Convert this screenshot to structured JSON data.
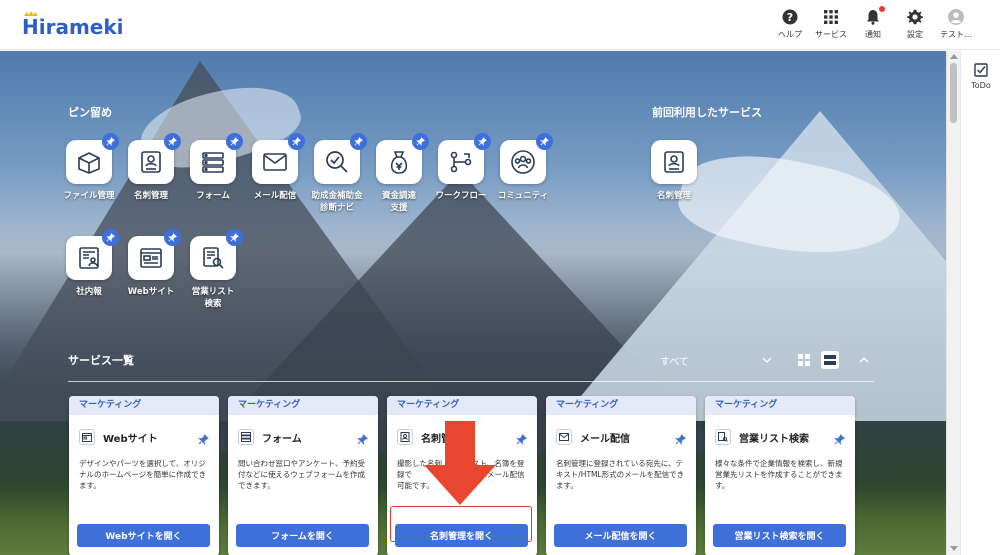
{
  "header": {
    "logo": "Hirameki 7",
    "nav": [
      {
        "label": "ヘルプ",
        "icon": "help-icon"
      },
      {
        "label": "サービス",
        "icon": "grid-icon"
      },
      {
        "label": "通知",
        "icon": "bell-icon"
      },
      {
        "label": "設定",
        "icon": "gear-icon"
      },
      {
        "label": "テスト…",
        "icon": "user-icon"
      }
    ]
  },
  "pinned": {
    "title": "ピン留め",
    "items": [
      {
        "label": "ファイル管理",
        "icon": "box-icon"
      },
      {
        "label": "名刺管理",
        "icon": "card-icon"
      },
      {
        "label": "フォーム",
        "icon": "form-icon"
      },
      {
        "label": "メール配信",
        "icon": "mail-icon"
      },
      {
        "label": "助成金補助金\n診断ナビ",
        "icon": "check-search-icon"
      },
      {
        "label": "資金調達\n支援",
        "icon": "money-bag-icon"
      },
      {
        "label": "ワークフロー",
        "icon": "workflow-icon"
      },
      {
        "label": "コミュニティ",
        "icon": "community-icon"
      },
      {
        "label": "社内報",
        "icon": "newsletter-icon"
      },
      {
        "label": "Webサイト",
        "icon": "website-icon"
      },
      {
        "label": "営業リスト\n検索",
        "icon": "list-search-icon"
      }
    ]
  },
  "recent": {
    "title": "前回利用したサービス",
    "items": [
      {
        "label": "名刺管理",
        "icon": "card-icon"
      }
    ]
  },
  "services": {
    "title": "サービス一覧",
    "filter": "すべて",
    "cards": [
      {
        "category": "マーケティング",
        "name": "Webサイト",
        "icon": "website-icon",
        "desc": "デザインやパーツを選択して、オリジナルのホームページを簡単に作成できます。",
        "button": "Webサイトを開く"
      },
      {
        "category": "マーケティング",
        "name": "フォーム",
        "icon": "form-icon",
        "desc": "問い合わせ窓口やアンケート、予約受付などに使えるウェブフォームを作成できます。",
        "button": "フォームを開く"
      },
      {
        "category": "マーケティング",
        "name": "名刺管",
        "icon": "card-icon",
        "desc": "撮影した名刺　　　　スト、名簿を登録で　　　　　たデータはメール配信　　　　可能です。",
        "button": "名刺管理を開く"
      },
      {
        "category": "マーケティング",
        "name": "メール配信",
        "icon": "mail-icon",
        "desc": "名刺管理に登録されている宛先に、テキスト/HTML形式のメールを配信できます。",
        "button": "メール配信を開く"
      },
      {
        "category": "マーケティング",
        "name": "営業リスト検索",
        "icon": "list-search-icon",
        "desc": "様々な条件で企業情報を検索し、新規営業先リストを作成することができます。",
        "button": "営業リスト検索を開く"
      }
    ]
  },
  "sidepanel": {
    "todo_label": "ToDo"
  },
  "colors": {
    "accent": "#3f6fd8",
    "brand": "#2f5fc4",
    "highlight": "#e53935"
  }
}
